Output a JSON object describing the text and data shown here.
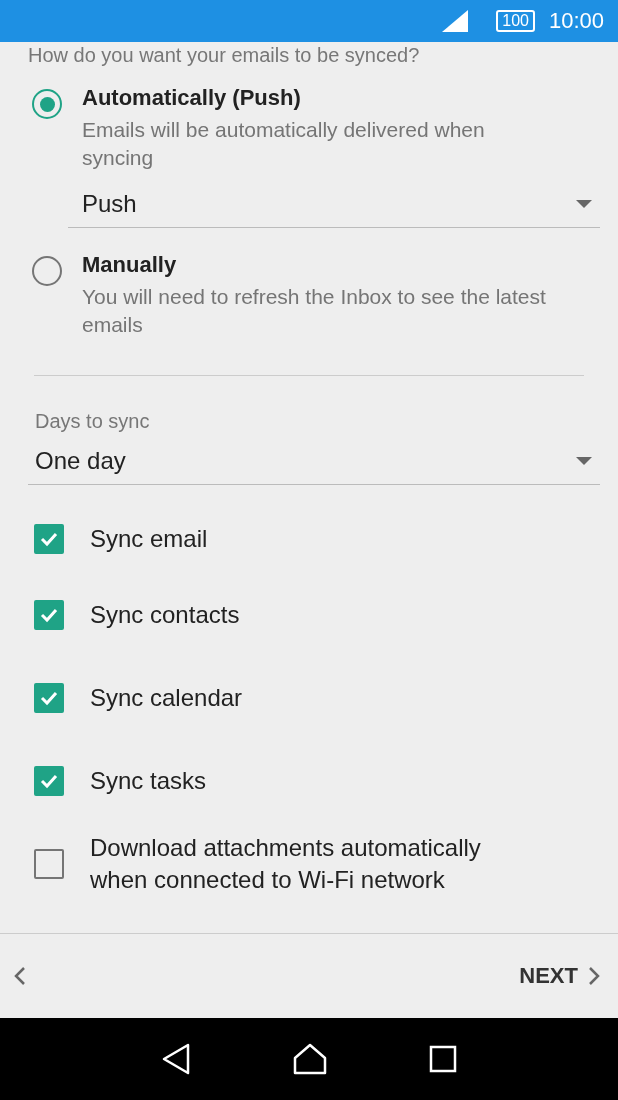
{
  "status_bar": {
    "battery": "100",
    "time": "10:00"
  },
  "heading": "How do you want your emails to be synced?",
  "sync_options": [
    {
      "title": "Automatically (Push)",
      "description": "Emails will be automatically delivered when syncing",
      "selected": true,
      "dropdown": "Push"
    },
    {
      "title": "Manually",
      "description": "You will need to refresh the Inbox to see the latest emails",
      "selected": false
    }
  ],
  "days_to_sync": {
    "label": "Days to sync",
    "value": "One day"
  },
  "checkboxes": [
    {
      "label": "Sync email",
      "checked": true
    },
    {
      "label": "Sync contacts",
      "checked": true
    },
    {
      "label": "Sync calendar",
      "checked": true
    },
    {
      "label": "Sync tasks",
      "checked": true
    },
    {
      "label": "Download attachments automatically when connected to Wi-Fi network",
      "checked": false
    }
  ],
  "footer": {
    "next": "NEXT"
  }
}
